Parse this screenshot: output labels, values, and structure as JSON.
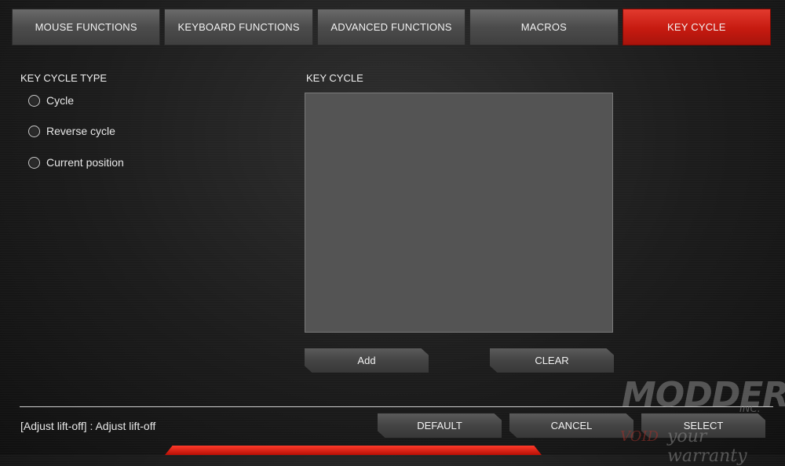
{
  "tabs": [
    {
      "label": "MOUSE FUNCTIONS",
      "active": false
    },
    {
      "label": "KEYBOARD FUNCTIONS",
      "active": false
    },
    {
      "label": "ADVANCED FUNCTIONS",
      "active": false
    },
    {
      "label": "MACROS",
      "active": false
    },
    {
      "label": "KEY CYCLE",
      "active": true
    }
  ],
  "key_cycle_type": {
    "title": "KEY CYCLE TYPE",
    "options": [
      {
        "label": "Cycle",
        "selected": false
      },
      {
        "label": "Reverse cycle",
        "selected": false
      },
      {
        "label": "Current position",
        "selected": false
      }
    ]
  },
  "key_cycle": {
    "title": "KEY CYCLE",
    "add_label": "Add",
    "clear_label": "CLEAR"
  },
  "footer": {
    "status_text": "[Adjust lift-off] : Adjust lift-off",
    "default_label": "DEFAULT",
    "cancel_label": "CANCEL",
    "select_label": "SELECT"
  },
  "watermark": {
    "brand": "MODDERS",
    "suffix": "INC.",
    "void": "VOID",
    "tagline": "your warranty"
  },
  "colors": {
    "accent": "#c61a10",
    "panel": "#545454"
  }
}
